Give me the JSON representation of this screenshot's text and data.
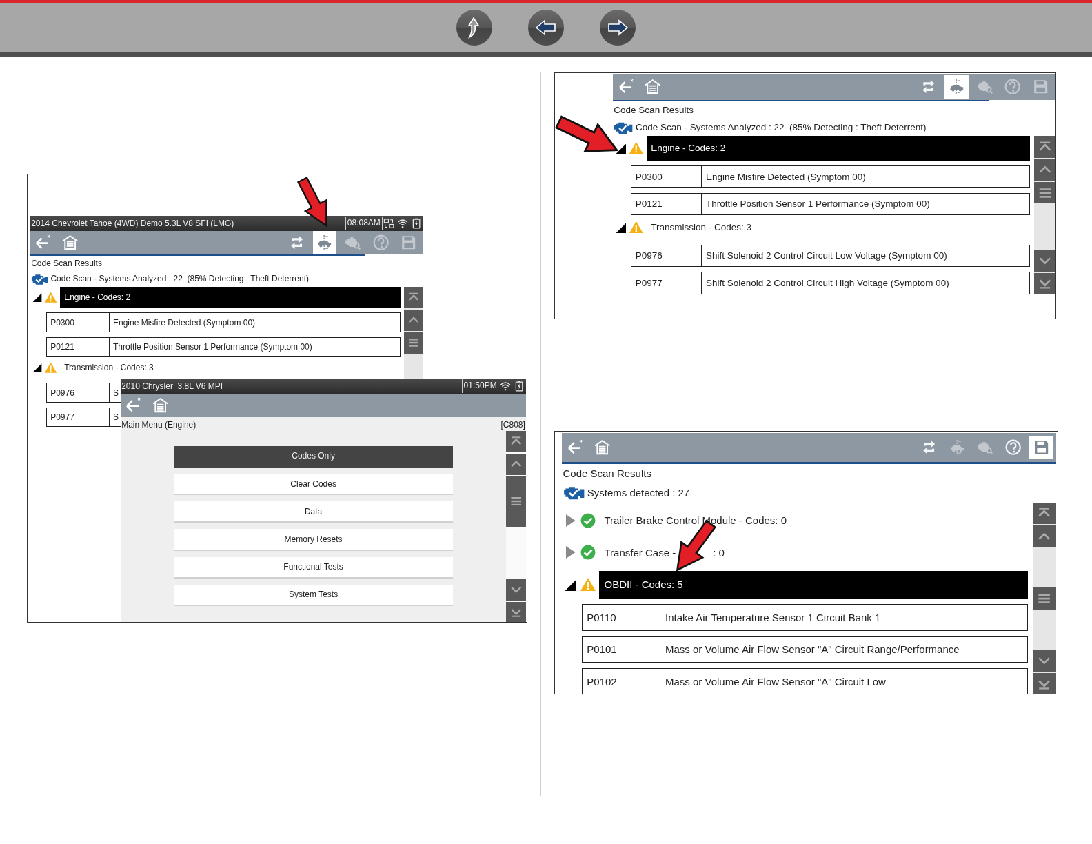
{
  "left_figure": {
    "back_screen": {
      "status_bar": {
        "vehicle": "2014 Chevrolet Tahoe (4WD) Demo 5.3L V8 SFI (LMG)",
        "time": "08:08AM",
        "vehicle_link": true
      },
      "tools": [
        {
          "kind": "refresh",
          "selected": false,
          "disabled": false
        },
        {
          "kind": "vehicle-scan",
          "selected": true,
          "disabled": false
        },
        {
          "kind": "engine-search",
          "selected": false,
          "disabled": true
        },
        {
          "kind": "help",
          "selected": false,
          "disabled": true
        },
        {
          "kind": "save",
          "selected": false,
          "disabled": true
        }
      ],
      "progress": {
        "level": 0.85
      },
      "title": "Code Scan Results",
      "summary": "Code Scan - Systems Analyzed : 22  (85% Detecting : Theft Deterrent)",
      "systems": [
        {
          "label_parts": [
            "Engine - Codes: 2"
          ],
          "kind": "warning",
          "expanded": true,
          "selected": true,
          "codes": [
            {
              "code": "P0300",
              "description": "Engine Misfire Detected (Symptom 00)"
            },
            {
              "code": "P0121",
              "description": "Throttle Position Sensor 1 Performance (Symptom 00)"
            }
          ]
        },
        {
          "label_parts": [
            "Transmission - Codes: 3"
          ],
          "kind": "warning",
          "expanded": true,
          "selected": false,
          "codes": [
            {
              "code": "P0976",
              "description": "S"
            },
            {
              "code": "P0977",
              "description": "S"
            }
          ]
        }
      ]
    },
    "front_screen": {
      "status_bar": {
        "vehicle": "2010 Chrysler  3.8L V6 MPI",
        "time": "01:50PM"
      },
      "title": "Main Menu (Engine)",
      "screen_code": "[C808]",
      "menu": [
        {
          "label": "Codes Only",
          "selected": true
        },
        {
          "label": "Clear Codes",
          "selected": false
        },
        {
          "label": "Data",
          "selected": false
        },
        {
          "label": "Memory Resets",
          "selected": false
        },
        {
          "label": "Functional Tests",
          "selected": false
        },
        {
          "label": "System Tests",
          "selected": false
        }
      ]
    }
  },
  "right_top_figure": {
    "screen": {
      "tools": [
        {
          "kind": "refresh",
          "selected": false,
          "disabled": false
        },
        {
          "kind": "vehicle-scan",
          "selected": true,
          "disabled": false
        },
        {
          "kind": "engine-search",
          "selected": false,
          "disabled": true
        },
        {
          "kind": "help",
          "selected": false,
          "disabled": true
        },
        {
          "kind": "save",
          "selected": false,
          "disabled": true
        }
      ],
      "progress": {
        "level": 0.85
      },
      "title": "Code Scan Results",
      "summary": "Code Scan - Systems Analyzed : 22  (85% Detecting : Theft Deterrent)",
      "systems": [
        {
          "label_parts": [
            "Engine - Codes: 2"
          ],
          "kind": "warning",
          "expanded": true,
          "selected": true,
          "codes": [
            {
              "code": "P0300",
              "description": "Engine Misfire Detected (Symptom 00)"
            },
            {
              "code": "P0121",
              "description": "Throttle Position Sensor 1 Performance (Symptom 00)"
            }
          ]
        },
        {
          "label_parts": [
            "Transmission - Codes: 3"
          ],
          "kind": "warning",
          "expanded": true,
          "selected": false,
          "codes": [
            {
              "code": "P0976",
              "description": "Shift Solenoid 2 Control Circuit Low Voltage (Symptom 00)"
            },
            {
              "code": "P0977",
              "description": "Shift Solenoid 2 Control Circuit High Voltage (Symptom 00)"
            }
          ]
        }
      ]
    }
  },
  "right_bottom_figure": {
    "screen": {
      "tools": [
        {
          "kind": "refresh",
          "selected": false,
          "disabled": false
        },
        {
          "kind": "vehicle-scan",
          "selected": false,
          "disabled": true
        },
        {
          "kind": "engine-search",
          "selected": false,
          "disabled": true
        },
        {
          "kind": "help",
          "selected": false,
          "disabled": false
        },
        {
          "kind": "save",
          "selected": true,
          "disabled": false
        }
      ],
      "progress": {
        "level": 1
      },
      "title": "Code Scan Results",
      "summary": "Systems detected : 27",
      "systems": [
        {
          "label_parts": [
            "Trailer Brake Control Module - Codes: 0"
          ],
          "kind": "ok",
          "expanded": false,
          "selected": false
        },
        {
          "label_parts": [
            "Transfer Case -",
            ": 0"
          ],
          "kind": "ok",
          "expanded": false,
          "selected": false
        },
        {
          "label_parts": [
            "OBDII - Codes: 5"
          ],
          "kind": "warning",
          "expanded": true,
          "selected": true,
          "codes": [
            {
              "code": "P0110",
              "description": "Intake Air Temperature Sensor 1 Circuit Bank 1"
            },
            {
              "code": "P0101",
              "description": "Mass or Volume Air Flow Sensor \"A\" Circuit Range/Performance"
            },
            {
              "code": "P0102",
              "description": "Mass or Volume Air Flow Sensor \"A\" Circuit Low"
            }
          ]
        }
      ]
    }
  }
}
